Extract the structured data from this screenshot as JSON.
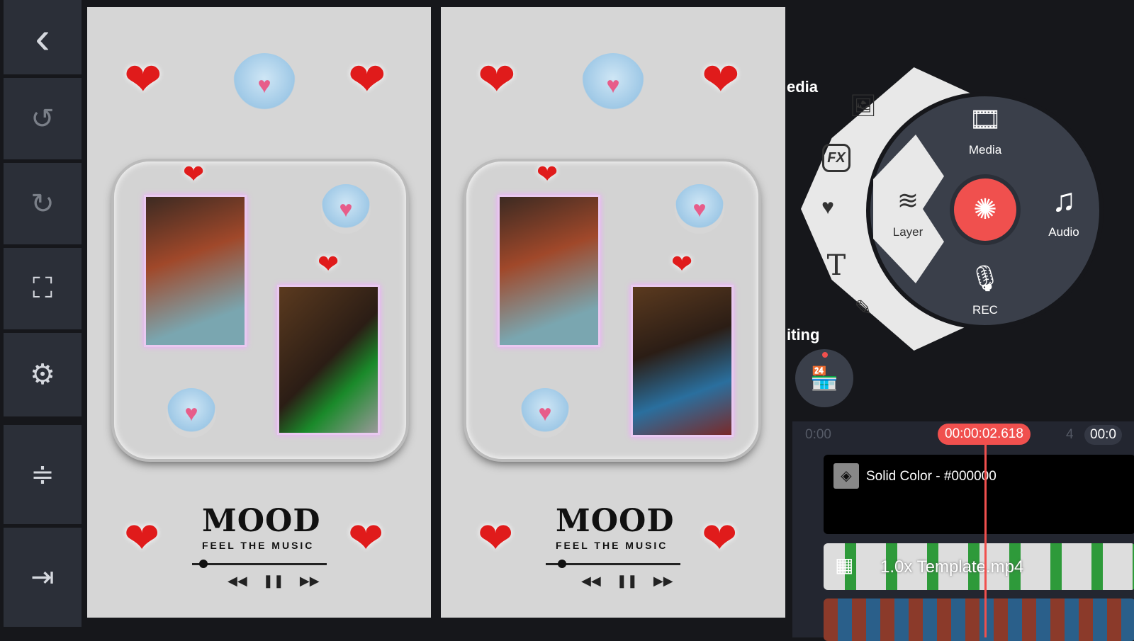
{
  "toolbar": {
    "items": [
      {
        "name": "back",
        "icon": "chevron-left-icon",
        "glyph": "‹"
      },
      {
        "name": "undo",
        "icon": "undo-icon",
        "glyph": "↺"
      },
      {
        "name": "redo",
        "icon": "redo-icon",
        "glyph": "↻"
      },
      {
        "name": "capture",
        "icon": "screenshot-icon",
        "glyph": "⛶"
      },
      {
        "name": "settings",
        "icon": "gear-icon",
        "glyph": "⚙"
      },
      {
        "name": "adjust",
        "icon": "track-height-icon",
        "glyph": "≑"
      },
      {
        "name": "export",
        "icon": "export-icon",
        "glyph": "⇥"
      }
    ]
  },
  "preview": {
    "title": "MOOD",
    "subtitle": "FEEL THE MUSIC",
    "controls": [
      "◀◀",
      "❚❚",
      "▶▶"
    ],
    "heart": "❤",
    "couple": "♥"
  },
  "side_labels": {
    "media": "edia",
    "editing": "iting"
  },
  "arc_menu": [
    {
      "name": "image-video",
      "icon": "image-video-icon",
      "glyph": "🖼"
    },
    {
      "name": "effects",
      "icon": "fx-icon",
      "glyph": "FX"
    },
    {
      "name": "sticker",
      "icon": "sticker-icon",
      "glyph": "♥"
    },
    {
      "name": "text",
      "icon": "text-icon",
      "glyph": "T"
    },
    {
      "name": "handwriting",
      "icon": "brush-icon",
      "glyph": "✎"
    }
  ],
  "wheel": {
    "media": "Media",
    "layer": "Layer",
    "audio": "Audio",
    "rec": "REC",
    "media_glyph": "🎞",
    "layer_glyph": "≋",
    "audio_glyph": "♫",
    "rec_glyph": "🎙",
    "capture_glyph": "✺"
  },
  "store_glyph": "🏪",
  "timeline": {
    "start": "0:00",
    "playhead": "00:00:02.618",
    "tick": "4",
    "end": "00:0",
    "tracks": [
      {
        "label": "Solid Color - #000000",
        "icon": "paint-bucket-icon"
      },
      {
        "label": "1.0x Template.mp4",
        "icon": "film-icon"
      }
    ]
  },
  "colors": {
    "accent": "#f0504e",
    "panel": "#2b2f38",
    "preview_bg": "#d6d6d6"
  }
}
